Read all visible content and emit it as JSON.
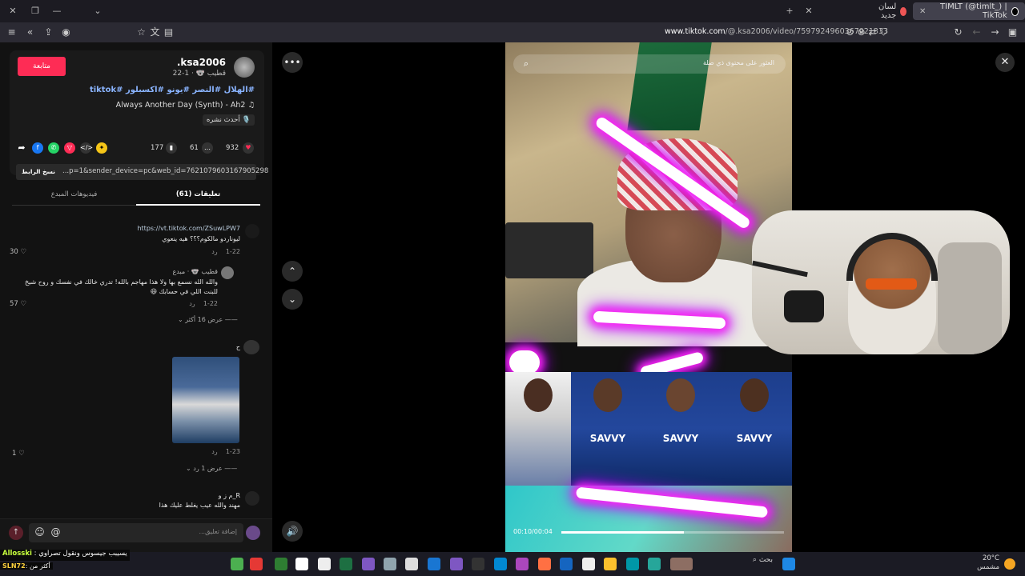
{
  "browser": {
    "tabs": [
      {
        "title": "TIMLT (@timlt_) | TikTok",
        "active": true
      },
      {
        "title": "لسان جديد",
        "active": false
      }
    ],
    "url_host": "www.tiktok.com",
    "url_path": "/@.ksa2006/video/7597924960367021333"
  },
  "post": {
    "follow_label": "متابعة",
    "username": ".ksa2006",
    "subline": "قطيب 🐨 · 1-22",
    "hashtags": "#الهلال #النصر #يونو #اكسبلور #tiktok",
    "music": "Always Another Day (Synth) - Ah2 ♫",
    "latest_badge": "أحدث نشره 🎙️",
    "likes": "932",
    "comments": "61",
    "saves": "177",
    "copy_link_label": "نسخ الرابط",
    "link_text": "...p=1&sender_device=pc&web_id=7621079603167905298"
  },
  "comment_tabs": {
    "comments": "تعليقات (61)",
    "creator_videos": "فيديوهات المبدع"
  },
  "comments": [
    {
      "name": "https://vt.tiktok.com/ZSuwLPW7",
      "text": "ليوناردو مالكوم؟؟؟ هيه ينعوي",
      "date": "1-22",
      "reply": "رد",
      "likes": "30"
    },
    {
      "name": "قطيب 🐨 · مبدع",
      "text": "والله الله نسمع بها ولا هذا مهاجم بالله! تدري خالك في نفسك و روح شيخ",
      "text2": "للبنت اللي في حسابك 😆",
      "date": "1-22",
      "reply": "رد",
      "likes": "57",
      "more": "عرض 16 أكثر"
    },
    {
      "name": "ح",
      "date": "1-23",
      "reply": "رد",
      "likes": "1",
      "more": "عرض 1 رد"
    },
    {
      "name": "R_م ز و",
      "text": "مهند والله عيب يغلط عليك هذا"
    }
  ],
  "input": {
    "placeholder": "إضافة تعليق..."
  },
  "video": {
    "search_placeholder": "العثور على محتوى ذي صلة",
    "timecode": "00:10/00:04",
    "progress": 0.55,
    "sponsor": "SAVVY"
  },
  "taskbar": {
    "search": "بحث",
    "temp": "20°C",
    "weather": "مشمس"
  },
  "overlay_chat": {
    "user1": "Allosski",
    "msg1": ": يسيبب جيسوس ونقول تصراوي",
    "user2": "SLN72",
    "msg2": ": أكثر من"
  },
  "colors": {
    "accent": "#fe2c55",
    "link": "#8ab4ff"
  }
}
